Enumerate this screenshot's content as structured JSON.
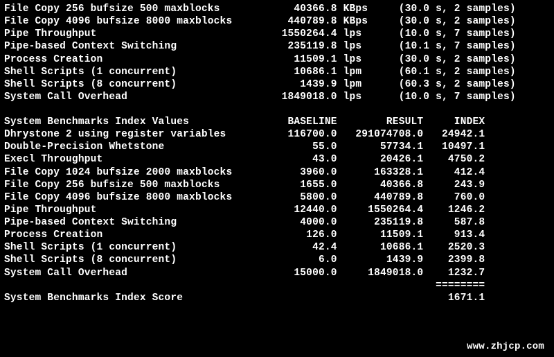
{
  "top_section": {
    "rows": [
      {
        "name": "File Copy 256 bufsize 500 maxblocks",
        "value": "40366.8",
        "unit": "KBps",
        "note": "(30.0 s, 2 samples)"
      },
      {
        "name": "File Copy 4096 bufsize 8000 maxblocks",
        "value": "440789.8",
        "unit": "KBps",
        "note": "(30.0 s, 2 samples)"
      },
      {
        "name": "Pipe Throughput",
        "value": "1550264.4",
        "unit": "lps",
        "note": "(10.0 s, 7 samples)"
      },
      {
        "name": "Pipe-based Context Switching",
        "value": "235119.8",
        "unit": "lps",
        "note": "(10.1 s, 7 samples)"
      },
      {
        "name": "Process Creation",
        "value": "11509.1",
        "unit": "lps",
        "note": "(30.0 s, 2 samples)"
      },
      {
        "name": "Shell Scripts (1 concurrent)",
        "value": "10686.1",
        "unit": "lpm",
        "note": "(60.1 s, 2 samples)"
      },
      {
        "name": "Shell Scripts (8 concurrent)",
        "value": "1439.9",
        "unit": "lpm",
        "note": "(60.3 s, 2 samples)"
      },
      {
        "name": "System Call Overhead",
        "value": "1849018.0",
        "unit": "lps",
        "note": "(10.0 s, 7 samples)"
      }
    ]
  },
  "index_section": {
    "heading": "System Benchmarks Index Values",
    "col_baseline": "BASELINE",
    "col_result": "RESULT",
    "col_index": "INDEX",
    "rows": [
      {
        "name": "Dhrystone 2 using register variables",
        "baseline": "116700.0",
        "result": "291074708.0",
        "index": "24942.1"
      },
      {
        "name": "Double-Precision Whetstone",
        "baseline": "55.0",
        "result": "57734.1",
        "index": "10497.1"
      },
      {
        "name": "Execl Throughput",
        "baseline": "43.0",
        "result": "20426.1",
        "index": "4750.2"
      },
      {
        "name": "File Copy 1024 bufsize 2000 maxblocks",
        "baseline": "3960.0",
        "result": "163328.1",
        "index": "412.4"
      },
      {
        "name": "File Copy 256 bufsize 500 maxblocks",
        "baseline": "1655.0",
        "result": "40366.8",
        "index": "243.9"
      },
      {
        "name": "File Copy 4096 bufsize 8000 maxblocks",
        "baseline": "5800.0",
        "result": "440789.8",
        "index": "760.0"
      },
      {
        "name": "Pipe Throughput",
        "baseline": "12440.0",
        "result": "1550264.4",
        "index": "1246.2"
      },
      {
        "name": "Pipe-based Context Switching",
        "baseline": "4000.0",
        "result": "235119.8",
        "index": "587.8"
      },
      {
        "name": "Process Creation",
        "baseline": "126.0",
        "result": "11509.1",
        "index": "913.4"
      },
      {
        "name": "Shell Scripts (1 concurrent)",
        "baseline": "42.4",
        "result": "10686.1",
        "index": "2520.3"
      },
      {
        "name": "Shell Scripts (8 concurrent)",
        "baseline": "6.0",
        "result": "1439.9",
        "index": "2399.8"
      },
      {
        "name": "System Call Overhead",
        "baseline": "15000.0",
        "result": "1849018.0",
        "index": "1232.7"
      }
    ],
    "separator": "========",
    "score_label": "System Benchmarks Index Score",
    "score_value": "1671.1"
  },
  "watermark": "www.zhjcp.com"
}
